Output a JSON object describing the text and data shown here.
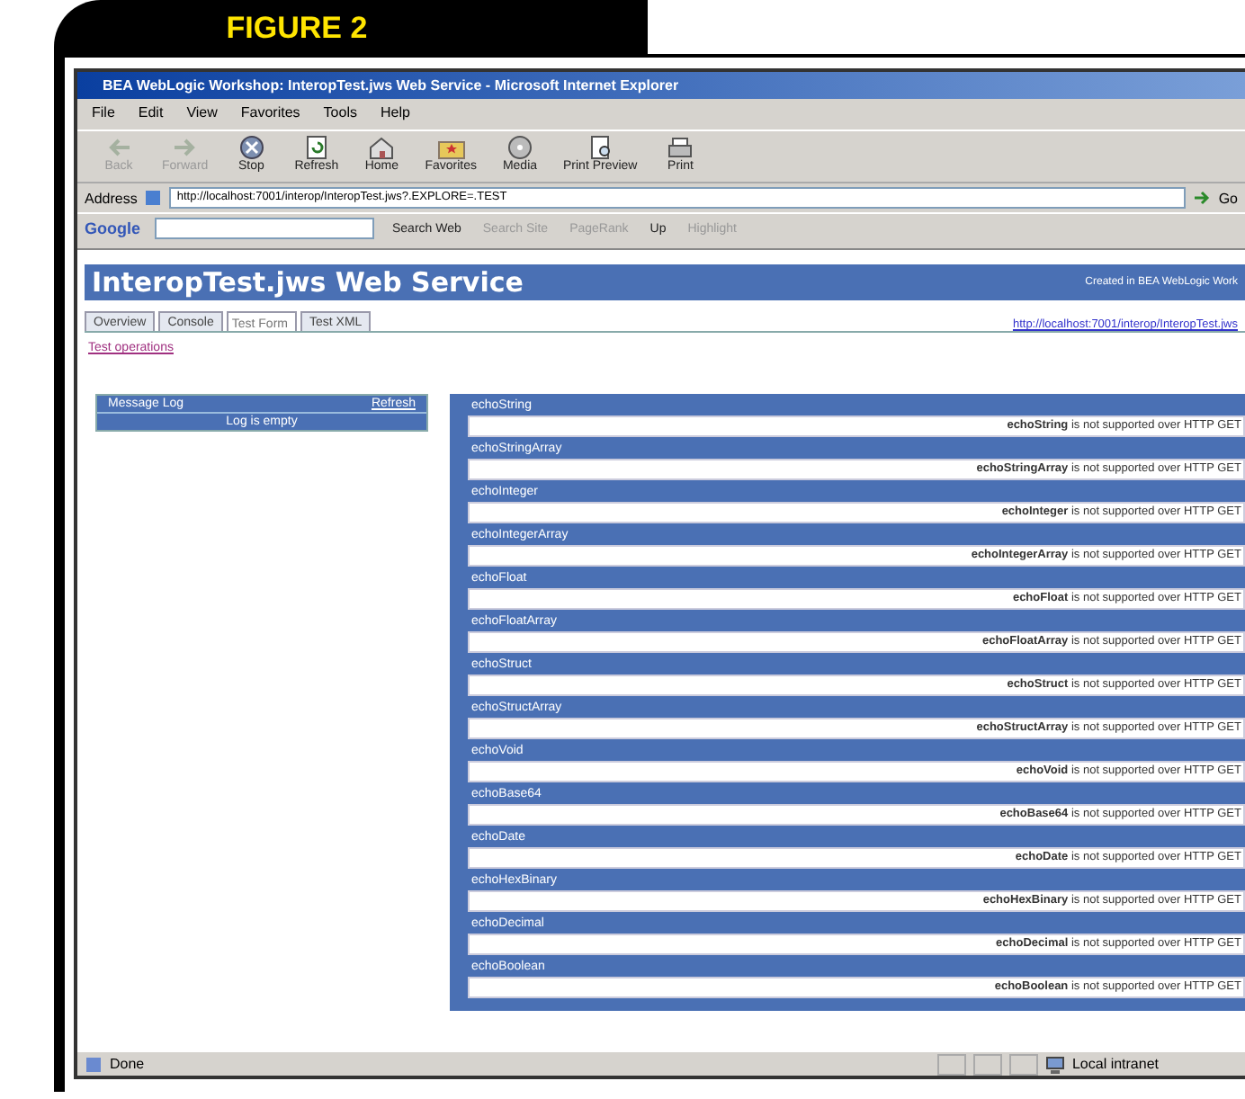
{
  "figure_label": "FIGURE 2",
  "window": {
    "title": "BEA WebLogic Workshop: InteropTest.jws Web Service - Microsoft Internet Explorer"
  },
  "menu": [
    "File",
    "Edit",
    "View",
    "Favorites",
    "Tools",
    "Help"
  ],
  "toolbar": [
    {
      "label": "Back",
      "disabled": true
    },
    {
      "label": "Forward",
      "disabled": true
    },
    {
      "label": "Stop",
      "disabled": false
    },
    {
      "label": "Refresh",
      "disabled": false
    },
    {
      "label": "Home",
      "disabled": false
    },
    {
      "label": "Favorites",
      "disabled": false
    },
    {
      "label": "Media",
      "disabled": false
    },
    {
      "label": "Print Preview",
      "disabled": false
    },
    {
      "label": "Print",
      "disabled": false
    }
  ],
  "address": {
    "label": "Address",
    "value": "http://localhost:7001/interop/InteropTest.jws?.EXPLORE=.TEST",
    "go": "Go"
  },
  "google_bar": {
    "logo": "Google",
    "buttons": [
      {
        "label": "Search Web",
        "disabled": false
      },
      {
        "label": "Search Site",
        "disabled": true
      },
      {
        "label": "PageRank",
        "disabled": true
      },
      {
        "label": "Up",
        "disabled": false
      },
      {
        "label": "Highlight",
        "disabled": true
      }
    ]
  },
  "page": {
    "header": "InteropTest.jws Web Service",
    "header_note": "Created in BEA WebLogic Work",
    "tabs": [
      {
        "label": "Overview",
        "selected": false
      },
      {
        "label": "Console",
        "selected": false
      },
      {
        "label": "Test Form",
        "selected": true
      },
      {
        "label": "Test XML",
        "selected": false
      }
    ],
    "service_url": "http://localhost:7001/interop/InteropTest.jws",
    "test_operations": "Test operations",
    "message_log": {
      "title": "Message Log",
      "refresh": "Refresh",
      "status": "Log is empty"
    },
    "operations": [
      {
        "name": "echoString",
        "result": "**echoString** is not supported over HTTP GET"
      },
      {
        "name": "echoStringArray",
        "result": "**echoStringArray** is not supported over HTTP GET"
      },
      {
        "name": "echoInteger",
        "result": "**echoInteger** is not supported over HTTP GET"
      },
      {
        "name": "echoIntegerArray",
        "result": "**echoIntegerArray** is not supported over HTTP GET"
      },
      {
        "name": "echoFloat",
        "result": "**echoFloat** is not supported over HTTP GET"
      },
      {
        "name": "echoFloatArray",
        "result": "**echoFloatArray** is not supported over HTTP GET"
      },
      {
        "name": "echoStruct",
        "result": "**echoStruct** is not supported over HTTP GET"
      },
      {
        "name": "echoStructArray",
        "result": "**echoStructArray** is not supported over HTTP GET"
      },
      {
        "name": "echoVoid",
        "result": "**echoVoid** is not supported over HTTP GET"
      },
      {
        "name": "echoBase64",
        "result": "**echoBase64** is not supported over HTTP GET"
      },
      {
        "name": "echoDate",
        "result": "**echoDate** is not supported over HTTP GET"
      },
      {
        "name": "echoHexBinary",
        "result": "**echoHexBinary** is not supported over HTTP GET"
      },
      {
        "name": "echoDecimal",
        "result": "**echoDecimal** is not supported over HTTP GET"
      },
      {
        "name": "echoBoolean",
        "result": "**echoBoolean** is not supported over HTTP GET"
      }
    ]
  },
  "status_bar": {
    "text": "Done",
    "zone": "Local intranet"
  }
}
